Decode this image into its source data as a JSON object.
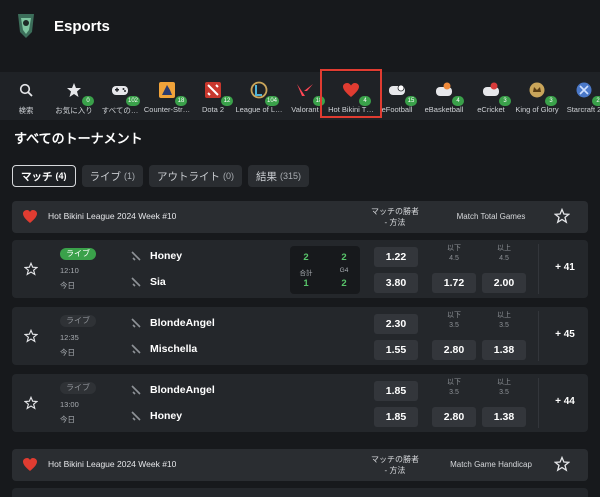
{
  "header": {
    "title": "Esports"
  },
  "categories": [
    {
      "label": "検索",
      "badge": "",
      "icon": "search-icon"
    },
    {
      "label": "お気に入り",
      "badge": "0",
      "icon": "favorites-star-icon"
    },
    {
      "label": "すべての…",
      "badge": "102",
      "icon": "controller-icon"
    },
    {
      "label": "Counter-Str…",
      "badge": "18",
      "icon": "counter-strike-icon"
    },
    {
      "label": "Dota 2",
      "badge": "12",
      "icon": "dota2-icon"
    },
    {
      "label": "League of L…",
      "badge": "104",
      "icon": "league-of-legends-icon"
    },
    {
      "label": "Valorant",
      "badge": "18",
      "icon": "valorant-icon"
    },
    {
      "label": "Hot Bikini T…",
      "badge": "4",
      "icon": "hot-bikini-icon"
    },
    {
      "label": "eFootball",
      "badge": "15",
      "icon": "efootball-icon"
    },
    {
      "label": "eBasketball",
      "badge": "4",
      "icon": "ebasketball-icon"
    },
    {
      "label": "eCricket",
      "badge": "3",
      "icon": "ecricket-icon"
    },
    {
      "label": "King of Glory",
      "badge": "3",
      "icon": "king-of-glory-icon"
    },
    {
      "label": "Starcraft 2",
      "badge": "2",
      "icon": "starcraft-icon"
    }
  ],
  "section": {
    "title": "すべてのトーナメント"
  },
  "tabs": [
    {
      "label": "マッチ",
      "count": "(4)"
    },
    {
      "label": "ライブ",
      "count": "(1)"
    },
    {
      "label": "アウトライト",
      "count": "(0)"
    },
    {
      "label": "結果",
      "count": "(315)"
    }
  ],
  "league1": {
    "name": "Hot Bikini League 2024 Week #10",
    "col_winner": "マッチの勝者 - 方法",
    "col_market": "Match Total Games"
  },
  "league2": {
    "name": "Hot Bikini League 2024 Week #10",
    "col_winner": "マッチの勝者 - 方法",
    "col_market": "Match Game Handicap"
  },
  "matches": [
    {
      "status": "ライブ",
      "time": "12:10",
      "day": "今日",
      "team1": "Honey",
      "team2": "Sia",
      "score": {
        "t1_a": "2",
        "t1_b": "2",
        "label_total": "合計",
        "label_game": "G4",
        "t2_a": "1",
        "t2_b": "2"
      },
      "odd1": "1.22",
      "odd2": "3.80",
      "under_label": "以下",
      "over_label": "以上",
      "line": "4.5",
      "under": "1.72",
      "over": "2.00",
      "more": "+ 41"
    },
    {
      "status": "ライブ",
      "time": "12:35",
      "day": "今日",
      "team1": "BlondeAngel",
      "team2": "Mischella",
      "odd1": "2.30",
      "odd2": "1.55",
      "under_label": "以下",
      "over_label": "以上",
      "line": "3.5",
      "under": "2.80",
      "over": "1.38",
      "more": "+ 45"
    },
    {
      "status": "ライブ",
      "time": "13:00",
      "day": "今日",
      "team1": "BlondeAngel",
      "team2": "Honey",
      "odd1": "1.85",
      "odd2": "1.85",
      "under_label": "以下",
      "over_label": "以上",
      "line": "3.5",
      "under": "2.80",
      "over": "1.38",
      "more": "+ 44"
    }
  ],
  "colors": {
    "accent_live": "#3aa14a",
    "selection_frame": "#e03c31",
    "score_green": "#58c46a"
  }
}
